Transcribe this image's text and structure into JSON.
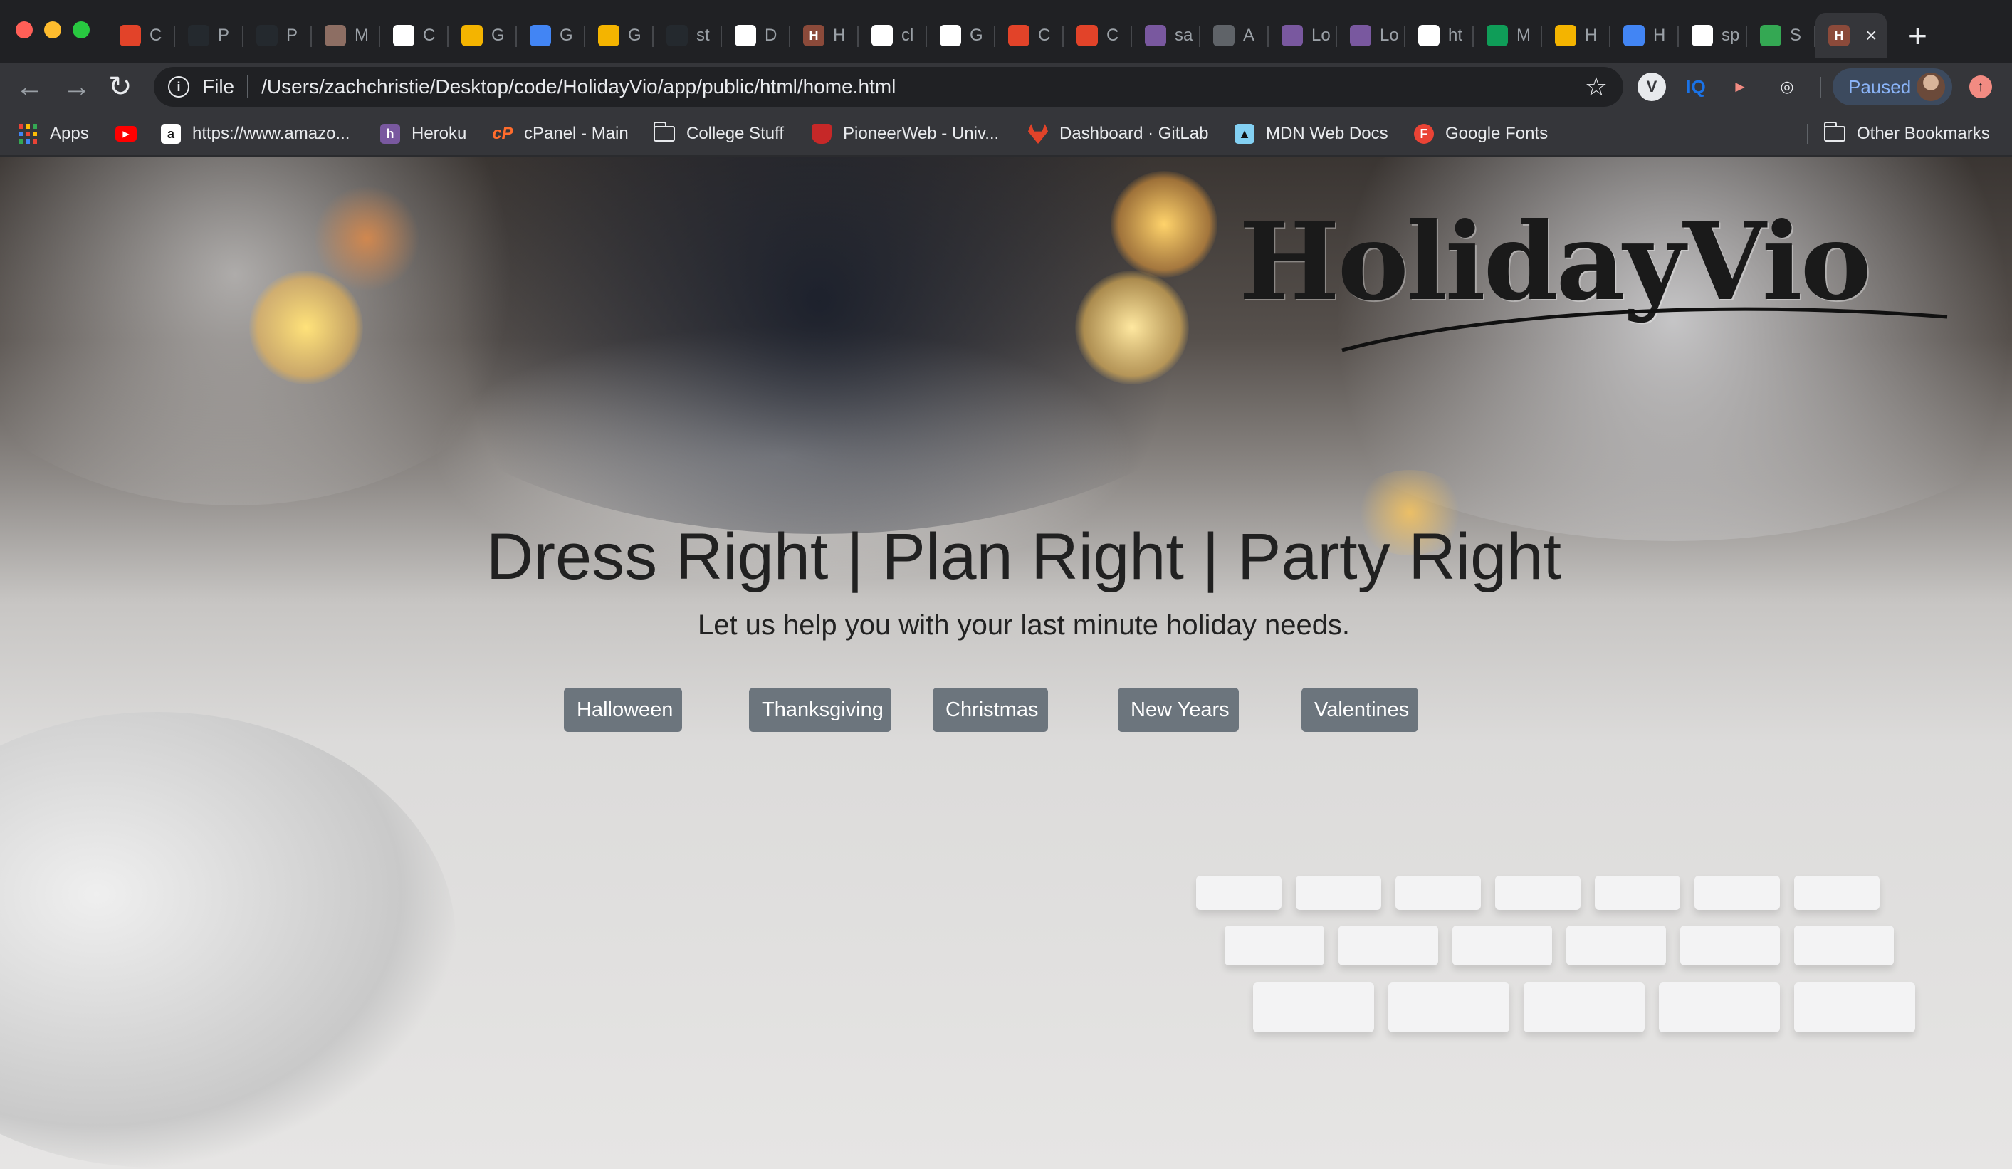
{
  "browser": {
    "tabs": [
      {
        "label": "C",
        "fav_color": "#e24329",
        "fav_glyph": "gitlab-icon"
      },
      {
        "label": "P",
        "fav_color": "#24292e",
        "fav_glyph": "github-icon"
      },
      {
        "label": "P",
        "fav_color": "#24292e",
        "fav_glyph": "github-icon"
      },
      {
        "label": "M",
        "fav_color": "#8d6e63",
        "fav_glyph": "cup-icon"
      },
      {
        "label": "C",
        "fav_color": "#ffffff",
        "fav_glyph": "codepen-icon"
      },
      {
        "label": "G",
        "fav_color": "#f4b400",
        "fav_glyph": "grade-icon"
      },
      {
        "label": "G",
        "fav_color": "#4285f4",
        "fav_glyph": "calendar-icon"
      },
      {
        "label": "G",
        "fav_color": "#f4b400",
        "fav_glyph": "grade-icon"
      },
      {
        "label": "st",
        "fav_color": "#24292e",
        "fav_glyph": "github-icon"
      },
      {
        "label": "D",
        "fav_color": "#ffffff",
        "fav_glyph": "codepen-icon"
      },
      {
        "label": "H",
        "fav_color": "#8b4a3a",
        "fav_glyph": "H"
      },
      {
        "label": "cl",
        "fav_color": "#ffffff",
        "fav_glyph": "google-icon"
      },
      {
        "label": "G",
        "fav_color": "#ffffff",
        "fav_glyph": "classroom-icon"
      },
      {
        "label": "C",
        "fav_color": "#e24329",
        "fav_glyph": "gitlab-icon"
      },
      {
        "label": "C",
        "fav_color": "#e24329",
        "fav_glyph": "gitlab-icon"
      },
      {
        "label": "sa",
        "fav_color": "#79589f",
        "fav_glyph": "heroku-icon"
      },
      {
        "label": "A",
        "fav_color": "#5f6368",
        "fav_glyph": "globe-icon"
      },
      {
        "label": "Lo",
        "fav_color": "#79589f",
        "fav_glyph": "heroku-icon"
      },
      {
        "label": "Lo",
        "fav_color": "#79589f",
        "fav_glyph": "heroku-icon"
      },
      {
        "label": "ht",
        "fav_color": "#ffffff",
        "fav_glyph": "globe-icon"
      },
      {
        "label": "M",
        "fav_color": "#0f9d58",
        "fav_glyph": "drive-icon"
      },
      {
        "label": "H",
        "fav_color": "#f4b400",
        "fav_glyph": "slides-icon"
      },
      {
        "label": "H",
        "fav_color": "#4285f4",
        "fav_glyph": "docs-icon"
      },
      {
        "label": "sp",
        "fav_color": "#ffffff",
        "fav_glyph": "google-icon"
      },
      {
        "label": "S",
        "fav_color": "#34a853",
        "fav_glyph": "maps-icon"
      },
      {
        "label": "",
        "fav_color": "#8b4a3a",
        "fav_glyph": "H",
        "active": true
      }
    ],
    "new_tab": "+",
    "close_glyph": "×",
    "address": {
      "scheme_label": "File",
      "url": "/Users/zachchristie/Desktop/code/HolidayVio/app/public/html/home.html"
    },
    "profile_label": "Paused",
    "extensions": [
      {
        "glyph": "V",
        "color": "#9aa0a6"
      },
      {
        "glyph": "IQ",
        "color": "#1a73e8"
      },
      {
        "glyph": "►",
        "color": "#f28b82"
      },
      {
        "glyph": "◎",
        "color": "#e8eaed"
      }
    ],
    "bookmarks": [
      {
        "label": "Apps",
        "icon": "apps-grid-icon"
      },
      {
        "label": "",
        "icon": "youtube-icon"
      },
      {
        "label": "https://www.amazo...",
        "icon": "amazon-icon"
      },
      {
        "label": "Heroku",
        "icon": "heroku-icon"
      },
      {
        "label": "cPanel - Main",
        "icon": "cpanel-icon"
      },
      {
        "label": "College Stuff",
        "icon": "folder-icon"
      },
      {
        "label": "PioneerWeb - Univ...",
        "icon": "shield-icon"
      },
      {
        "label": "Dashboard · GitLab",
        "icon": "gitlab-icon"
      },
      {
        "label": "MDN Web Docs",
        "icon": "mdn-icon"
      },
      {
        "label": "Google Fonts",
        "icon": "google-fonts-icon"
      }
    ],
    "other_bookmarks": "Other Bookmarks"
  },
  "page": {
    "logo_text": "HolidayVio",
    "headline": "Dress Right | Plan Right | Party Right",
    "subline": "Let us help you with your last minute holiday needs.",
    "buttons": [
      {
        "label": "Halloween"
      },
      {
        "label": "Thanksgiving"
      },
      {
        "label": "Christmas"
      },
      {
        "label": "New Years"
      },
      {
        "label": "Valentines"
      }
    ],
    "colors": {
      "button_bg": "#6c757d",
      "headline": "#212121"
    }
  }
}
